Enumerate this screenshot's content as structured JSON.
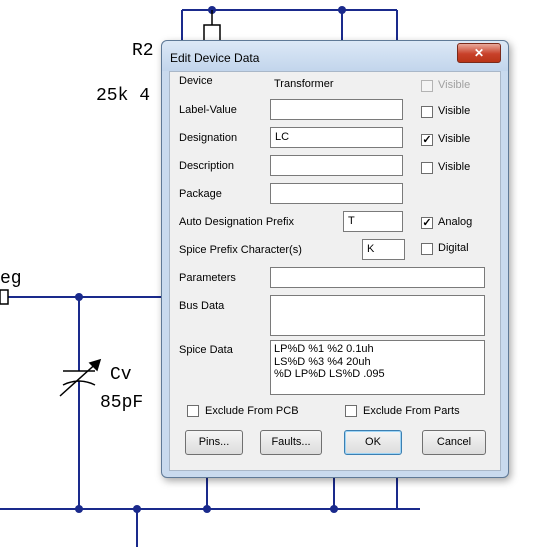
{
  "schematic": {
    "labels": {
      "r2": "R2",
      "r_value": "25k 4",
      "reg": "eg",
      "cv": "Cv",
      "cv_value": "85pF"
    }
  },
  "dialog": {
    "title": "Edit Device Data",
    "close_label": "✕",
    "device": {
      "label": "Device",
      "value": "Transformer",
      "visible_label": "Visible",
      "visible_checked": false,
      "visible_enabled": false
    },
    "label_value": {
      "label": "Label-Value",
      "value": "",
      "visible_label": "Visible",
      "visible_checked": false
    },
    "designation": {
      "label": "Designation",
      "value": "LC",
      "visible_label": "Visible",
      "visible_checked": true
    },
    "description": {
      "label": "Description",
      "value": "",
      "visible_label": "Visible",
      "visible_checked": false
    },
    "package": {
      "label": "Package",
      "value": ""
    },
    "auto_prefix": {
      "label": "Auto Designation Prefix",
      "value": "T"
    },
    "analog": {
      "label": "Analog",
      "checked": true
    },
    "spice_prefix": {
      "label": "Spice Prefix Character(s)",
      "value": "K"
    },
    "digital": {
      "label": "Digital",
      "checked": false
    },
    "parameters": {
      "label": "Parameters",
      "value": ""
    },
    "bus_data": {
      "label": "Bus Data",
      "value": ""
    },
    "spice_data": {
      "label": "Spice Data",
      "value": "LP%D %1 %2 0.1uh\nLS%D %3 %4 20uh\n%D LP%D LS%D .095"
    },
    "exclude_pcb": {
      "label": "Exclude From PCB",
      "checked": false
    },
    "exclude_parts": {
      "label": "Exclude From Parts",
      "checked": false
    },
    "buttons": {
      "pins": "Pins...",
      "faults": "Faults...",
      "ok": "OK",
      "cancel": "Cancel"
    }
  }
}
